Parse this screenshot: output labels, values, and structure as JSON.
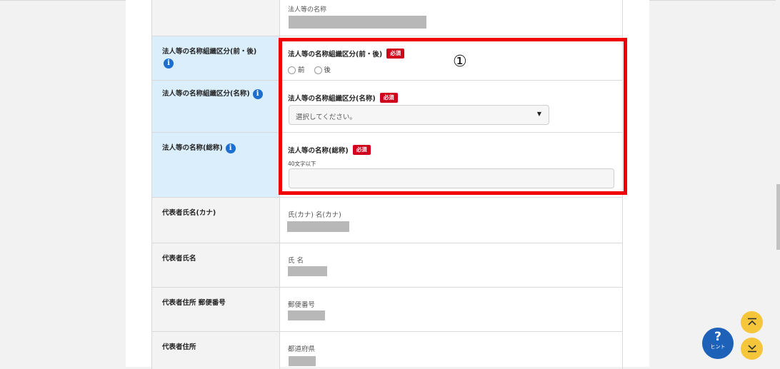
{
  "rows": {
    "name_display": {
      "sub_label": "法人等の名称"
    },
    "org_position": {
      "label_line1": "法人等の名称組織区分(前・後)",
      "field_label": "法人等の名称組織区分(前・後)",
      "required": "必須",
      "options": [
        "前",
        "後"
      ]
    },
    "org_type": {
      "label": "法人等の名称組織区分(名称)",
      "field_label": "法人等の名称組織区分(名称)",
      "required": "必須",
      "select_value": "選択してください。"
    },
    "full_name": {
      "label": "法人等の名称(総称)",
      "field_label": "法人等の名称(総称)",
      "required": "必須",
      "hint": "40文字以下",
      "value": ""
    },
    "rep_kana": {
      "label": "代表者氏名(カナ)",
      "field_label": "氏(カナ) 名(カナ)"
    },
    "rep_name": {
      "label": "代表者氏名",
      "field_label": "氏 名"
    },
    "rep_postal": {
      "label": "代表者住所 郵便番号",
      "field_label": "郵便番号"
    },
    "rep_address": {
      "label": "代表者住所",
      "field_label": "都道府県"
    }
  },
  "annotation": "①",
  "icons": {
    "info": "info-icon",
    "select_arrow": "triangle-down-icon",
    "scroll_top": "chevron-up-bar-icon",
    "scroll_bottom": "chevron-down-bar-icon"
  },
  "hint_button": {
    "symbol": "?",
    "label": "ヒント"
  },
  "colors": {
    "label_blue": "#dbeefc",
    "required_red": "#d0021b",
    "highlight_red": "#f00000",
    "hint_blue": "#1d62b8",
    "scroll_yellow": "#f5c53a"
  }
}
